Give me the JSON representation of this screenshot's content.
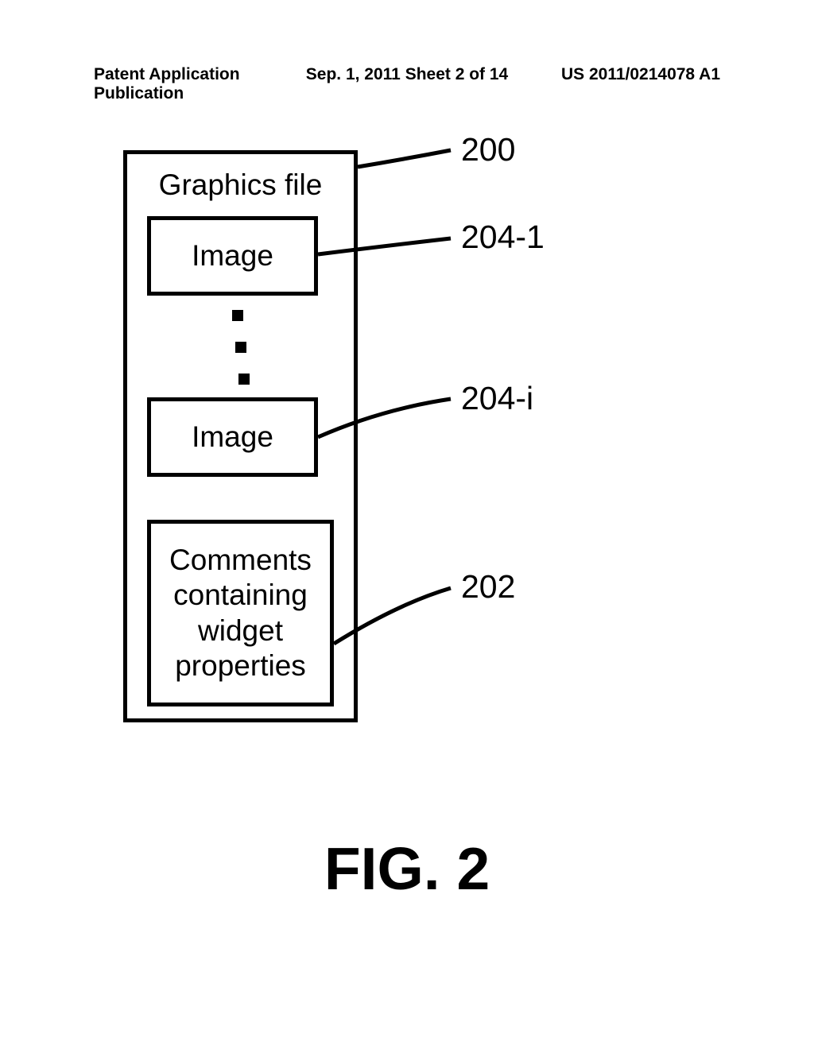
{
  "header": {
    "left": "Patent Application Publication",
    "center": "Sep. 1, 2011  Sheet 2 of 14",
    "right": "US 2011/0214078 A1"
  },
  "diagram": {
    "title": "Graphics file",
    "box1": "Image",
    "box2": "Image",
    "box3": "Comments containing widget properties"
  },
  "refs": {
    "r200": "200",
    "r204_1": "204-1",
    "r204_i": "204-i",
    "r202": "202"
  },
  "figure_caption": "FIG. 2"
}
